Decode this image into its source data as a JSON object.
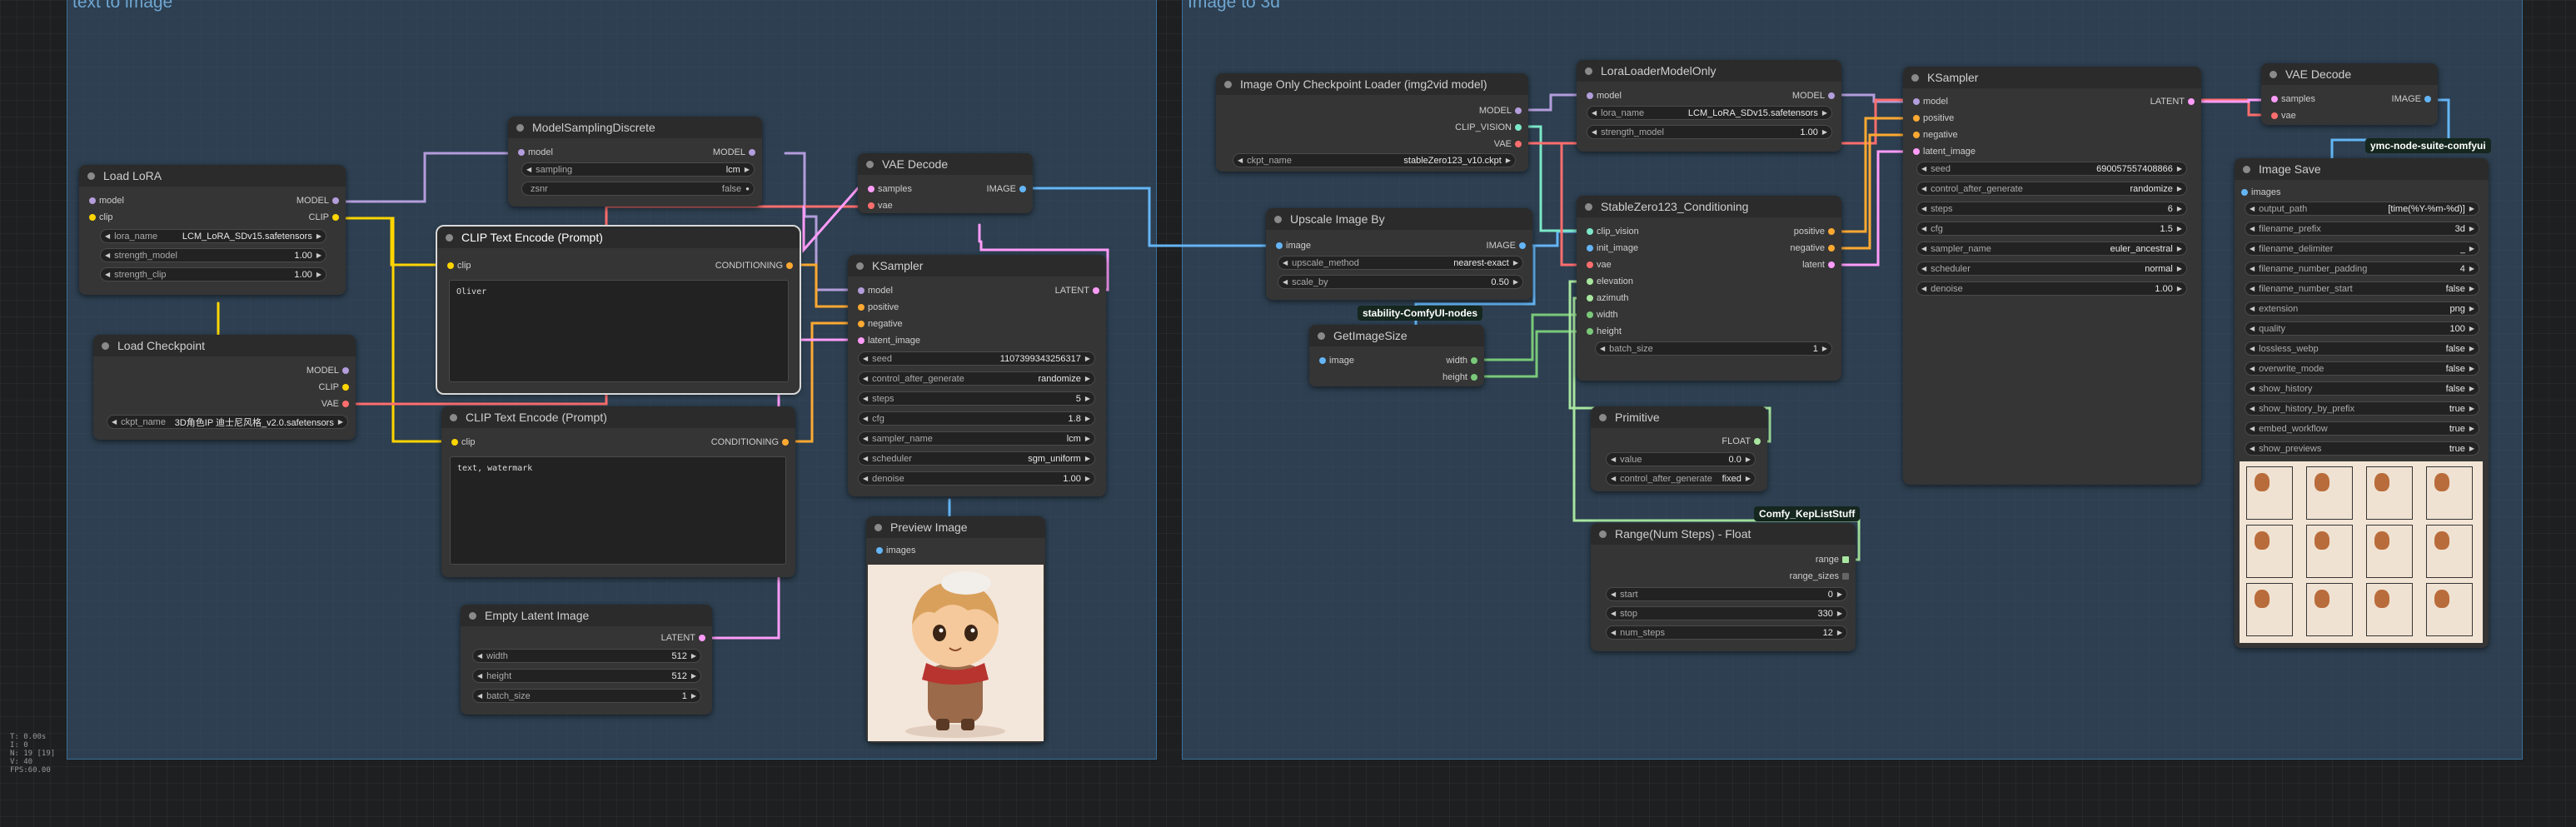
{
  "groups": {
    "left": "text to image",
    "right": "Image to 3d"
  },
  "badges": {
    "stability": "stability-ComfyUI-nodes",
    "ymc": "ymc-node-suite-comfyui",
    "kep": "Comfy_KepListStuff"
  },
  "stats": [
    "T: 0.00s",
    "I: 0",
    "N: 19 [19]",
    "V: 40",
    "FPS:60.00"
  ],
  "load_lora": {
    "title": "Load LoRA",
    "in_model": "model",
    "in_clip": "clip",
    "out_model": "MODEL",
    "out_clip": "CLIP",
    "lora_name_label": "lora_name",
    "lora_name": "LCM_LoRA_SDv15.safetensors",
    "strength_model_label": "strength_model",
    "strength_model": "1.00",
    "strength_clip_label": "strength_clip",
    "strength_clip": "1.00"
  },
  "load_checkpoint": {
    "title": "Load Checkpoint",
    "out_model": "MODEL",
    "out_clip": "CLIP",
    "out_vae": "VAE",
    "ckpt_label": "ckpt_name",
    "ckpt_name": "3D角色IP 迪士尼风格_v2.0.safetensors"
  },
  "model_sampling": {
    "title": "ModelSamplingDiscrete",
    "in_model": "model",
    "out_model": "MODEL",
    "sampling_label": "sampling",
    "sampling": "lcm",
    "zsnr_label": "zsnr",
    "zsnr": "false"
  },
  "clip_pos": {
    "title": "CLIP Text Encode (Prompt)",
    "in_clip": "clip",
    "out": "CONDITIONING",
    "text": "Oliver"
  },
  "clip_neg": {
    "title": "CLIP Text Encode (Prompt)",
    "in_clip": "clip",
    "out": "CONDITIONING",
    "text": "text, watermark"
  },
  "vae_decode_left": {
    "title": "VAE Decode",
    "in_samples": "samples",
    "in_vae": "vae",
    "out_image": "IMAGE"
  },
  "ksampler_left": {
    "title": "KSampler",
    "in_model": "model",
    "in_positive": "positive",
    "in_negative": "negative",
    "in_latent": "latent_image",
    "out_latent": "LATENT",
    "widgets": [
      {
        "label": "seed",
        "value": "1107399343256317"
      },
      {
        "label": "control_after_generate",
        "value": "randomize"
      },
      {
        "label": "steps",
        "value": "5"
      },
      {
        "label": "cfg",
        "value": "1.8"
      },
      {
        "label": "sampler_name",
        "value": "lcm"
      },
      {
        "label": "scheduler",
        "value": "sgm_uniform"
      },
      {
        "label": "denoise",
        "value": "1.00"
      }
    ]
  },
  "empty_latent": {
    "title": "Empty Latent Image",
    "out_latent": "LATENT",
    "widgets": [
      {
        "label": "width",
        "value": "512"
      },
      {
        "label": "height",
        "value": "512"
      },
      {
        "label": "batch_size",
        "value": "1"
      }
    ]
  },
  "preview_image": {
    "title": "Preview Image",
    "in_images": "images"
  },
  "img_ckpt": {
    "title": "Image Only Checkpoint Loader (img2vid model)",
    "out_model": "MODEL",
    "out_clip_vision": "CLIP_VISION",
    "out_vae": "VAE",
    "ckpt_label": "ckpt_name",
    "ckpt_name": "stableZero123_v10.ckpt"
  },
  "lora_loader_model": {
    "title": "LoraLoaderModelOnly",
    "in_model": "model",
    "out_model": "MODEL",
    "lora_label": "lora_name",
    "lora_name": "LCM_LoRA_SDv15.safetensors",
    "strength_label": "strength_model",
    "strength": "1.00"
  },
  "upscale": {
    "title": "Upscale Image By",
    "in_image": "image",
    "out_image": "IMAGE",
    "method_label": "upscale_method",
    "method": "nearest-exact",
    "scale_label": "scale_by",
    "scale": "0.50"
  },
  "get_image_size": {
    "title": "GetImageSize",
    "in_image": "image",
    "out_width": "width",
    "out_height": "height"
  },
  "sz123": {
    "title": "StableZero123_Conditioning",
    "in_clip_vision": "clip_vision",
    "in_init_image": "init_image",
    "in_vae": "vae",
    "in_elevation": "elevation",
    "in_azimuth": "azimuth",
    "in_width": "width",
    "in_height": "height",
    "out_positive": "positive",
    "out_negative": "negative",
    "out_latent": "latent",
    "batch_label": "batch_size",
    "batch": "1"
  },
  "primitive": {
    "title": "Primitive",
    "out_float": "FLOAT",
    "value_label": "value",
    "value": "0.0",
    "control_label": "control_after_generate",
    "control": "fixed"
  },
  "range_node": {
    "title": "Range(Num Steps) - Float",
    "out_range": "range",
    "out_range_sizes": "range_sizes",
    "widgets": [
      {
        "label": "start",
        "value": "0"
      },
      {
        "label": "stop",
        "value": "330"
      },
      {
        "label": "num_steps",
        "value": "12"
      }
    ]
  },
  "ksampler_right": {
    "title": "KSampler",
    "in_model": "model",
    "in_positive": "positive",
    "in_negative": "negative",
    "in_latent": "latent_image",
    "out_latent": "LATENT",
    "widgets": [
      {
        "label": "seed",
        "value": "690057557408866"
      },
      {
        "label": "control_after_generate",
        "value": "randomize"
      },
      {
        "label": "steps",
        "value": "6"
      },
      {
        "label": "cfg",
        "value": "1.5"
      },
      {
        "label": "sampler_name",
        "value": "euler_ancestral"
      },
      {
        "label": "scheduler",
        "value": "normal"
      },
      {
        "label": "denoise",
        "value": "1.00"
      }
    ]
  },
  "vae_decode_right": {
    "title": "VAE Decode",
    "in_samples": "samples",
    "in_vae": "vae",
    "out_image": "IMAGE"
  },
  "image_save": {
    "title": "Image Save",
    "in_images": "images",
    "widgets": [
      {
        "label": "output_path",
        "value": "[time(%Y-%m-%d)]"
      },
      {
        "label": "filename_prefix",
        "value": "3d"
      },
      {
        "label": "filename_delimiter",
        "value": "_"
      },
      {
        "label": "filename_number_padding",
        "value": "4"
      },
      {
        "label": "filename_number_start",
        "value": "false"
      },
      {
        "label": "extension",
        "value": "png"
      },
      {
        "label": "quality",
        "value": "100"
      },
      {
        "label": "lossless_webp",
        "value": "false"
      },
      {
        "label": "overwrite_mode",
        "value": "false"
      },
      {
        "label": "show_history",
        "value": "false"
      },
      {
        "label": "show_history_by_prefix",
        "value": "true"
      },
      {
        "label": "embed_workflow",
        "value": "true"
      },
      {
        "label": "show_previews",
        "value": "true"
      }
    ]
  }
}
